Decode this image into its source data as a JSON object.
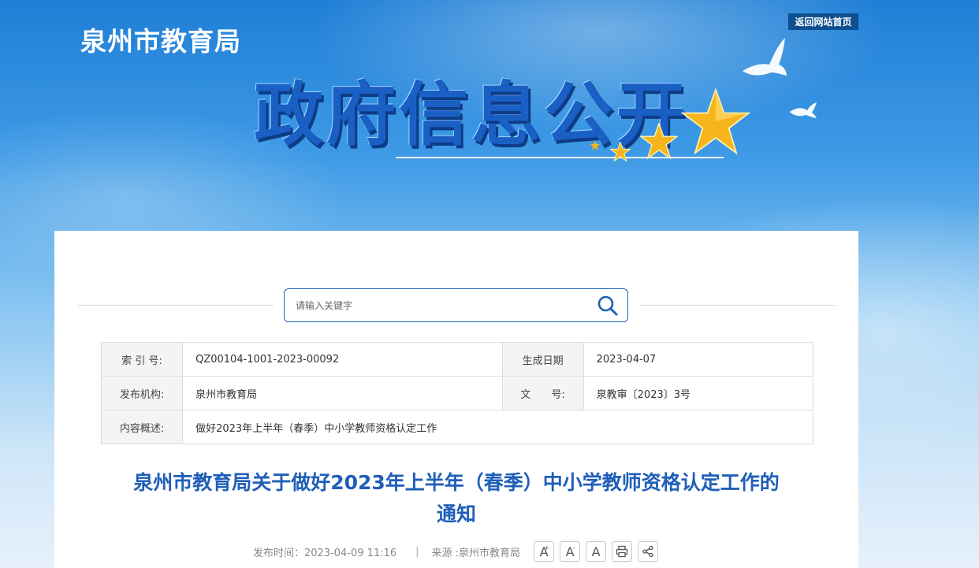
{
  "header": {
    "site_title": "泉州市教育局",
    "home_link": "返回网站首页",
    "banner_title": "政府信息公开"
  },
  "search": {
    "placeholder": "请输入关键字",
    "icon": "search-icon"
  },
  "meta_table": {
    "index_label": "索 引 号:",
    "index_value": "QZ00104-1001-2023-00092",
    "date_label": "生成日期",
    "date_value": "2023-04-07",
    "publisher_label": "发布机构:",
    "publisher_value": "泉州市教育局",
    "docno_label": "文　　号:",
    "docno_value": "泉教审〔2023〕3号",
    "summary_label": "内容概述:",
    "summary_value": "做好2023年上半年（春季）中小学教师资格认定工作"
  },
  "article": {
    "title_line1": "泉州市教育局关于做好2023年上半年（春季）中小学教师资格认定工作的",
    "title_line2": "通知",
    "publish_time": "发布时间：2023-04-09 11:16",
    "separator": "|",
    "source": "来源 :泉州市教育局"
  },
  "tools": {
    "font_up": "A",
    "font_up_mark": "+",
    "font_down": "A",
    "font_down_mark": "-",
    "font_default": "A",
    "print_icon": "print-icon",
    "share_icon": "share-icon"
  },
  "colors": {
    "accent": "#1f5fb8",
    "home_link_bg": "#0d4f8f",
    "banner_title": "#1a5fc4"
  }
}
